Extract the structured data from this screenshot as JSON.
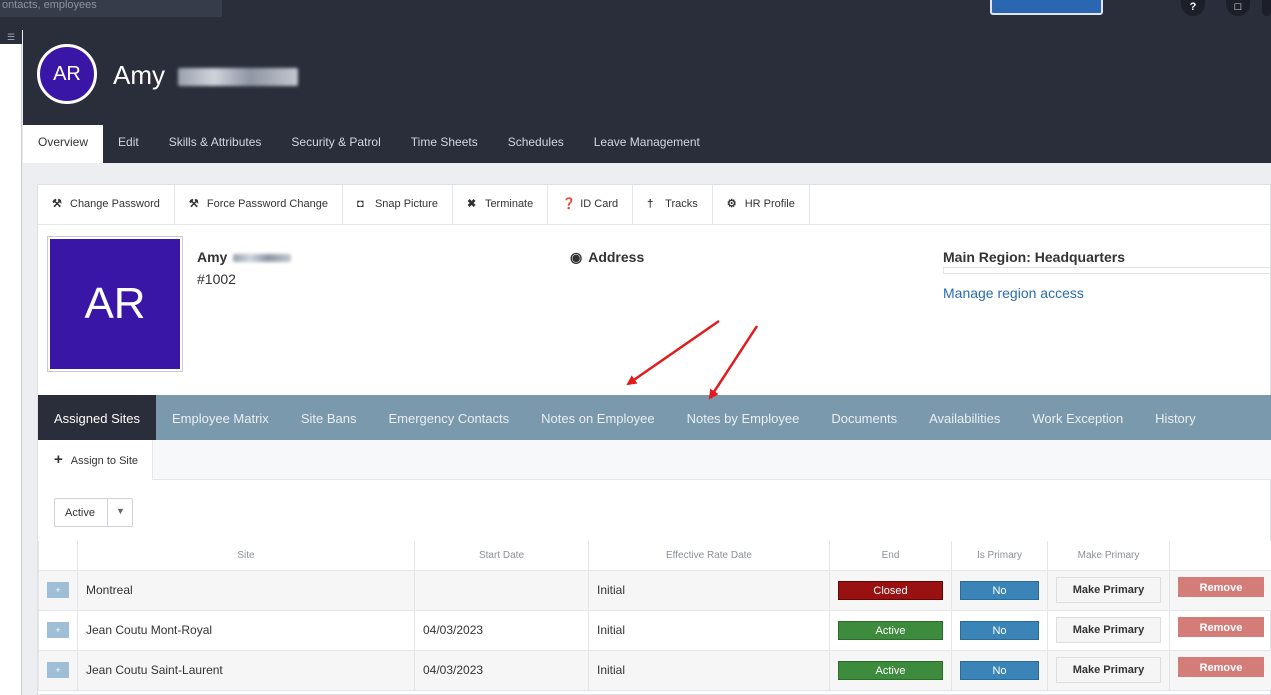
{
  "topbar": {
    "search_placeholder": "ontacts, employees",
    "help_icon": "?",
    "alerts_icon": "□"
  },
  "header": {
    "avatar_initials": "AR",
    "name": "Amy",
    "nav": [
      "Overview",
      "Edit",
      "Skills & Attributes",
      "Security & Patrol",
      "Time Sheets",
      "Schedules",
      "Leave Management"
    ]
  },
  "actions": [
    {
      "icon": "wrench-icon",
      "glyph": "⚒",
      "label": "Change Password"
    },
    {
      "icon": "wrench-icon",
      "glyph": "⚒",
      "label": "Force Password Change"
    },
    {
      "icon": "camera-icon",
      "glyph": "◘",
      "label": "Snap Picture"
    },
    {
      "icon": "x-icon",
      "glyph": "✖",
      "label": "Terminate"
    },
    {
      "icon": "question-circle-icon",
      "glyph": "❓",
      "label": "ID Card"
    },
    {
      "icon": "map-pin-icon",
      "glyph": "†",
      "label": "Tracks"
    },
    {
      "icon": "gear-icon",
      "glyph": "⚙",
      "label": "HR Profile"
    }
  ],
  "profile": {
    "photo_initials": "AR",
    "first_name": "Amy",
    "number": "#1002",
    "address_label": "Address",
    "region_label": "Main Region: Headquarters",
    "region_link": "Manage region access"
  },
  "tabs": [
    "Assigned Sites",
    "Employee Matrix",
    "Site Bans",
    "Emergency Contacts",
    "Notes on Employee",
    "Notes by Employee",
    "Documents",
    "Availabilities",
    "Work Exception",
    "History"
  ],
  "subbar": {
    "assign_label": "Assign to Site"
  },
  "filter": {
    "value": "Active"
  },
  "table": {
    "columns": [
      "Site",
      "Start Date",
      "Effective Rate Date",
      "End",
      "Is Primary",
      "Make Primary"
    ],
    "rows": [
      {
        "site": "Montreal",
        "start": "",
        "rate": "Initial",
        "end": "Closed",
        "primary": "No",
        "make": "Make Primary",
        "remove": "Remove"
      },
      {
        "site": "Jean Coutu Mont-Royal",
        "start": "04/03/2023",
        "rate": "Initial",
        "end": "Active",
        "primary": "No",
        "make": "Make Primary",
        "remove": "Remove"
      },
      {
        "site": "Jean Coutu Saint-Laurent",
        "start": "04/03/2023",
        "rate": "Initial",
        "end": "Active",
        "primary": "No",
        "make": "Make Primary",
        "remove": "Remove"
      }
    ]
  },
  "colors": {
    "accent_purple": "#3a16a6",
    "tab_bar": "#7a99ad",
    "closed": "#9a1111",
    "active": "#3d8b3d",
    "no": "#3a84b8",
    "remove": "#d47c78",
    "arrow": "#e41a1a"
  }
}
